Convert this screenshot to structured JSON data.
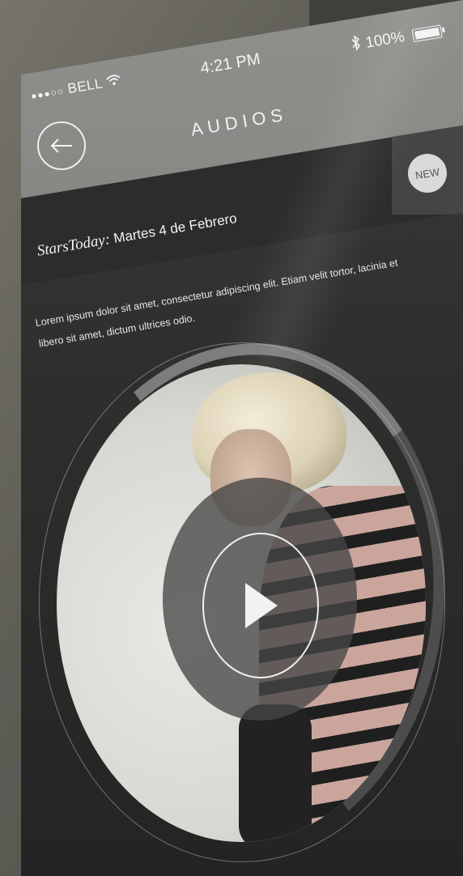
{
  "status_bar": {
    "carrier_dots": "●●●○○",
    "carrier": "BELL",
    "wifi_icon": "wifi-icon",
    "time": "4:21 PM",
    "bluetooth_icon": "bluetooth-icon",
    "battery_percent": "100%",
    "battery_level": 1.0
  },
  "header": {
    "title": "AUDIOS",
    "back_icon": "arrow-left-icon",
    "badge": "NEW"
  },
  "episode": {
    "brand": "StarsToday:",
    "date": "Martes 4 de Febrero",
    "description": "Lorem ipsum dolor sit amet, consectetur adipiscing elit. Etiam velit tortor, lacinia et libero sit amet, dictum ultrices odio."
  },
  "player": {
    "play_icon": "play-icon",
    "progress": 0.15
  },
  "colors": {
    "status_band": "#8c8c89",
    "dark_band": "#2c2c2d",
    "badge_bg": "#d9d9d7",
    "text": "#f2f2f2"
  }
}
